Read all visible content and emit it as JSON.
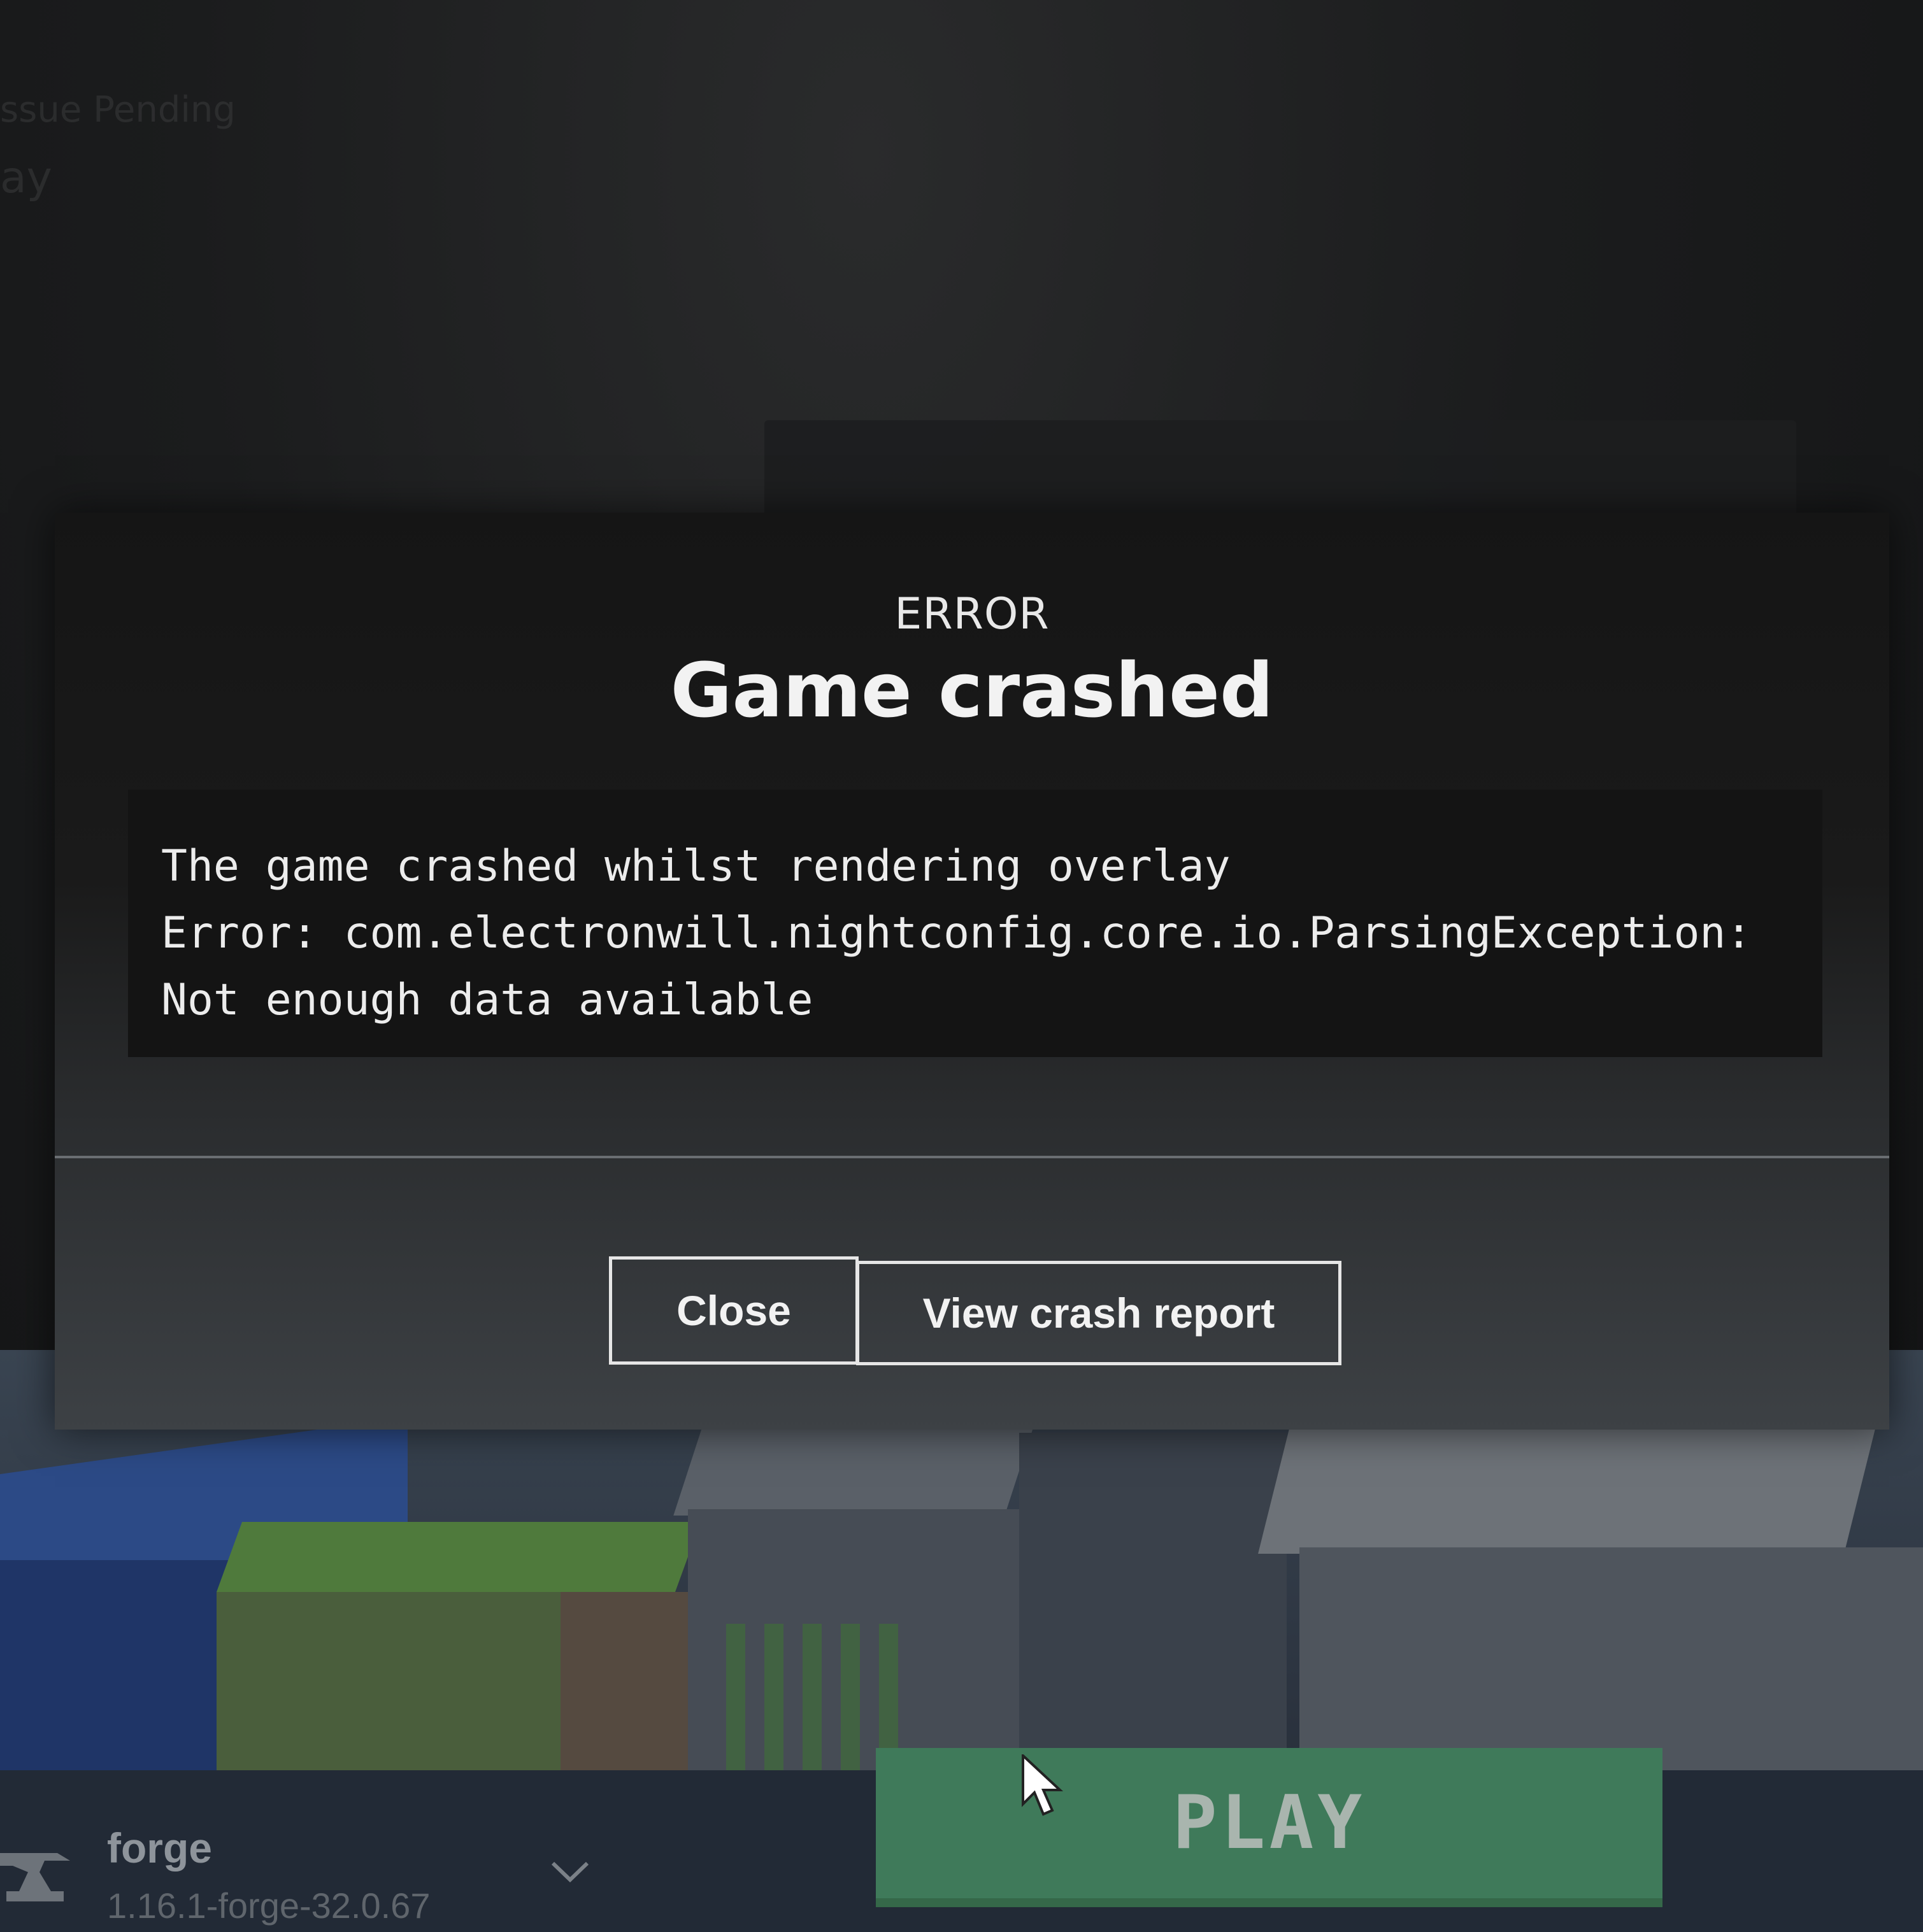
{
  "background": {
    "top_line_1": "ssue Pending",
    "top_line_2": "ay"
  },
  "dialog": {
    "kicker": "ERROR",
    "title": "Game crashed",
    "message_lines": [
      "The game crashed whilst rendering overlay",
      "Error: com.electronwill.nightconfig.core.io.ParsingException:",
      "Not enough data available"
    ],
    "buttons": {
      "close": "Close",
      "view_report": "View crash report"
    }
  },
  "launcher": {
    "profile_name": "forge",
    "profile_version": "1.16.1-forge-32.0.67",
    "play_label": "PLAY",
    "colors": {
      "play_green": "#3f7a5a",
      "bar_bg": "#222a36"
    }
  },
  "icons": {
    "profile": "anvil-icon",
    "dropdown": "chevron-down-icon",
    "pointer": "mouse-cursor-icon"
  }
}
